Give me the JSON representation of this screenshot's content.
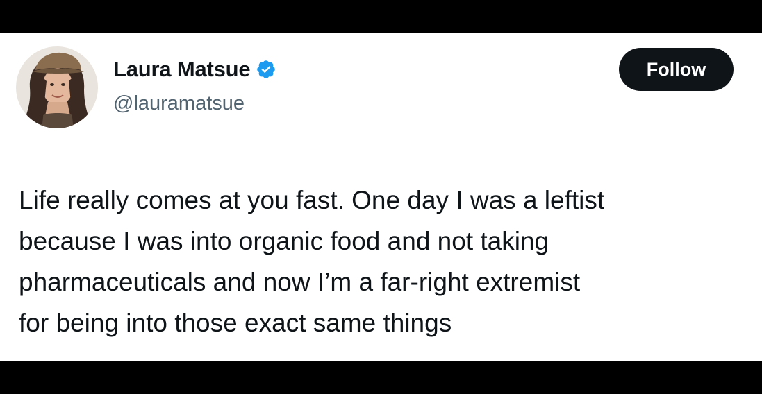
{
  "author": {
    "display_name": "Laura Matsue",
    "handle": "@lauramatsue",
    "verified": true,
    "verified_icon": "verified-badge-icon",
    "avatar": "profile-photo"
  },
  "actions": {
    "follow_label": "Follow"
  },
  "tweet": {
    "lines": [
      "Life really comes at you fast. One day I was a leftist",
      "because I was into organic food and not taking",
      "pharmaceuticals and now I’m a far-right extremist",
      "for being into those exact same things"
    ]
  },
  "colors": {
    "text": "#0f1419",
    "secondary_text": "#536471",
    "verified_blue": "#1d9bf0",
    "follow_bg": "#0f1419",
    "follow_text": "#ffffff",
    "letterbox": "#000000"
  }
}
